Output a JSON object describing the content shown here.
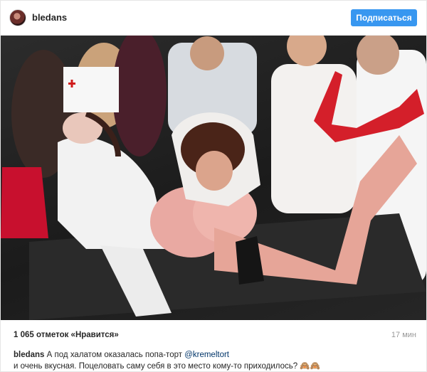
{
  "header": {
    "username": "bledans",
    "follow_label": "Подписаться"
  },
  "post": {
    "likes_text": "1 065 отметок «Нравится»",
    "time_ago": "17 мин",
    "caption": {
      "username": "bledans",
      "text_part1": "А под халатом оказалась попа-торт",
      "mention": "@kremeltort",
      "text_part2": "и очень вкусная. Поцеловать саму себя в это место кому-то приходилось? 🙈🙈"
    }
  },
  "colors": {
    "accent": "#3897f0",
    "mention": "#003569"
  },
  "icons": [
    "avatar",
    "cross-icon"
  ]
}
